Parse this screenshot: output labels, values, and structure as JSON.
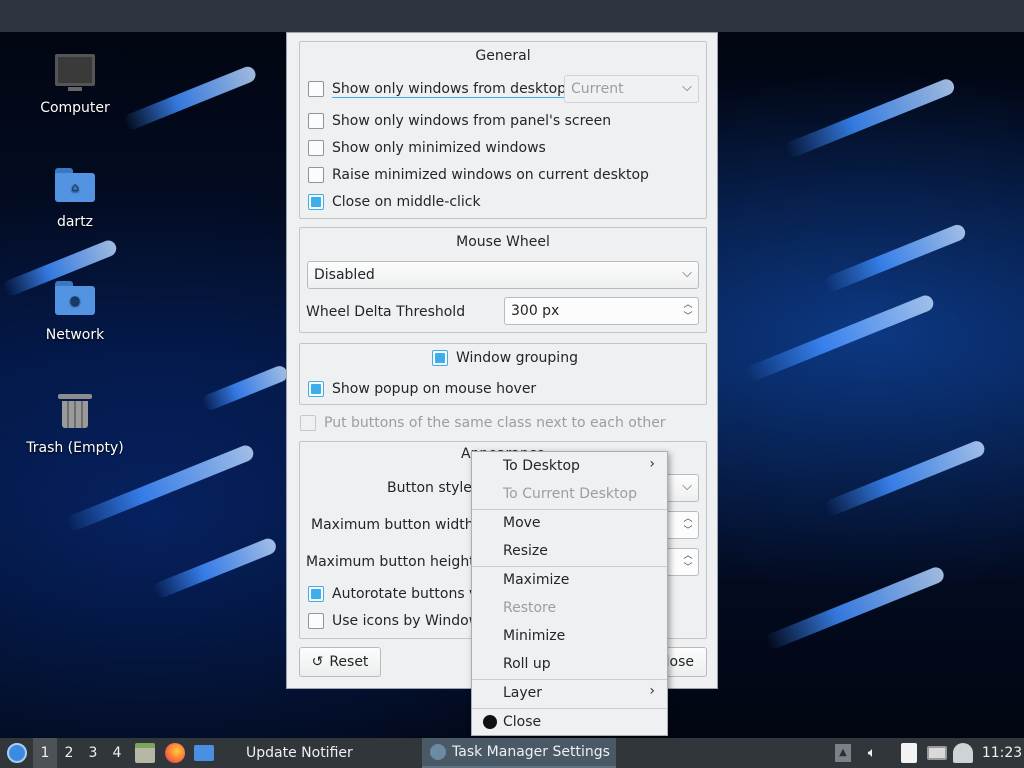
{
  "desktop": {
    "icons": [
      {
        "label": "Computer",
        "icon": "computer-icon"
      },
      {
        "label": "dartz",
        "icon": "home-folder-icon"
      },
      {
        "label": "Network",
        "icon": "network-folder-icon"
      },
      {
        "label": "Trash (Empty)",
        "icon": "trash-icon"
      }
    ]
  },
  "dialog": {
    "general": {
      "title": "General",
      "show_from_desktop": {
        "label": "Show only windows from desktop",
        "checked": false
      },
      "desktop_combo": "Current",
      "show_from_screen": {
        "label": "Show only windows from panel's screen",
        "checked": false
      },
      "show_minimized": {
        "label": "Show only minimized windows",
        "checked": false
      },
      "raise_minimized": {
        "label": "Raise minimized windows on current desktop",
        "checked": false
      },
      "close_middle": {
        "label": "Close on middle-click",
        "checked": true
      }
    },
    "mouse_wheel": {
      "title": "Mouse Wheel",
      "mode": "Disabled",
      "threshold_label": "Wheel Delta Threshold",
      "threshold_value": "300 px"
    },
    "grouping": {
      "title": "Window grouping",
      "checked": true,
      "popup": {
        "label": "Show popup on mouse hover",
        "checked": true
      }
    },
    "same_class": {
      "label": "Put buttons of the same class next to each other",
      "checked": false
    },
    "appearance": {
      "title": "Appearance",
      "button_style_label": "Button style",
      "max_width_label": "Maximum button width",
      "max_height_label": "Maximum button height",
      "autorotate": {
        "label": "Autorotate buttons v",
        "checked": true
      },
      "use_icons": {
        "label": "Use icons by Window",
        "checked": false
      }
    },
    "buttons": {
      "reset": "Reset",
      "reset_icon": "undo-icon",
      "close_visible": "lose"
    }
  },
  "context_menu": {
    "items": [
      {
        "label": "To Desktop",
        "submenu": true,
        "disabled": false
      },
      {
        "label": "To Current Desktop",
        "submenu": false,
        "disabled": true
      },
      {
        "label": "Move",
        "disabled": false
      },
      {
        "label": "Resize",
        "disabled": false
      },
      {
        "label": "Maximize",
        "disabled": false
      },
      {
        "label": "Restore",
        "disabled": true
      },
      {
        "label": "Minimize",
        "disabled": false
      },
      {
        "label": "Roll up",
        "disabled": false
      },
      {
        "label": "Layer",
        "submenu": true,
        "disabled": false
      },
      {
        "label": "Close",
        "disabled": false
      }
    ]
  },
  "taskbar": {
    "desktops": [
      "1",
      "2",
      "3",
      "4"
    ],
    "active_desktop": "1",
    "tasks": [
      {
        "label": "Update Notifier",
        "active": false
      },
      {
        "label": "Task Manager Settings",
        "active": true
      }
    ],
    "clock": "11:23"
  },
  "colors": {
    "accent": "#3daee9",
    "dialog_bg": "#eff0f1",
    "taskbar_bg": "#31363b"
  }
}
